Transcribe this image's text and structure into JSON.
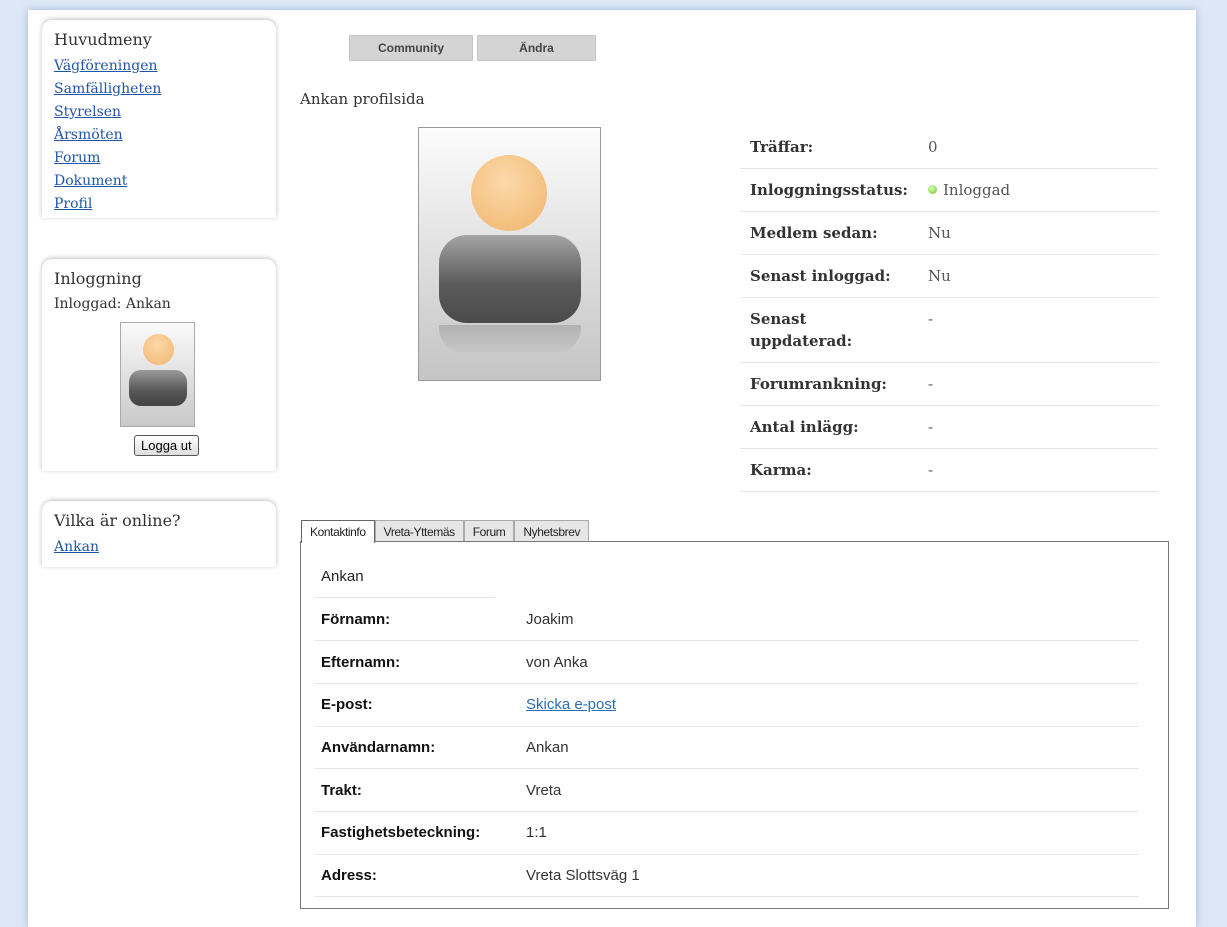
{
  "sidebar": {
    "menu": {
      "title": "Huvudmeny",
      "items": [
        {
          "label": "Vägföreningen"
        },
        {
          "label": "Samfälligheten"
        },
        {
          "label": "Styrelsen"
        },
        {
          "label": "Årsmöten"
        },
        {
          "label": "Forum"
        },
        {
          "label": "Dokument"
        },
        {
          "label": "Profil"
        }
      ]
    },
    "login": {
      "title": "Inloggning",
      "logged_in_text": "Inloggad: Ankan",
      "logout_label": "Logga ut"
    },
    "online": {
      "title": "Vilka är online?",
      "users": [
        "Ankan"
      ]
    }
  },
  "toolbar": {
    "community_label": "Community",
    "edit_label": "Ändra"
  },
  "profile": {
    "title": "Ankan profilsida",
    "stats": [
      {
        "label": "Träffar:",
        "value": "0"
      },
      {
        "label": "Inloggningsstatus:",
        "value": "Inloggad"
      },
      {
        "label": "Medlem sedan:",
        "value": "Nu"
      },
      {
        "label": "Senast inloggad:",
        "value": "Nu"
      },
      {
        "label": "Senast uppdaterad:",
        "value": "-"
      },
      {
        "label": "Forumrankning:",
        "value": "-"
      },
      {
        "label": "Antal inlägg:",
        "value": "-"
      },
      {
        "label": "Karma:",
        "value": "-"
      }
    ]
  },
  "tabs": [
    {
      "label": "Kontaktinfo",
      "active": true
    },
    {
      "label": "Vreta-Yttemäs"
    },
    {
      "label": "Forum"
    },
    {
      "label": "Nyhetsbrev"
    }
  ],
  "contact": {
    "username_heading": "Ankan",
    "rows": [
      {
        "label": "Förnamn:",
        "value": "Joakim"
      },
      {
        "label": "Efternamn:",
        "value": "von Anka"
      },
      {
        "label": "E-post:",
        "value": "Skicka e-post"
      },
      {
        "label": "Användarnamn:",
        "value": "Ankan"
      },
      {
        "label": "Trakt:",
        "value": "Vreta"
      },
      {
        "label": "Fastighetsbeteckning:",
        "value": "1:1"
      },
      {
        "label": "Adress:",
        "value": "Vreta Slottsväg 1"
      }
    ]
  },
  "colors": {
    "background": "#dde8f6",
    "link": "#2255a8",
    "status_online": "#5aa32a"
  }
}
